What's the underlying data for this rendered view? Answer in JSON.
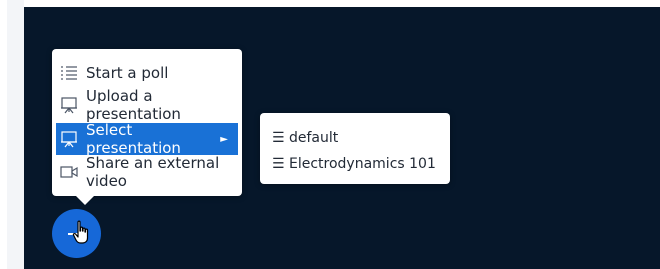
{
  "menu": {
    "items": [
      {
        "label": "Start a poll",
        "icon": "poll-list-icon",
        "selected": false
      },
      {
        "label": "Upload a presentation",
        "icon": "presentation-icon",
        "selected": false
      },
      {
        "label": "Select presentation",
        "icon": "presentation-icon",
        "selected": true
      },
      {
        "label": "Share an external video",
        "icon": "video-camera-icon",
        "selected": false
      }
    ],
    "submenu_arrow": "►"
  },
  "submenu": {
    "items": [
      {
        "label": "default",
        "icon": "☰"
      },
      {
        "label": "Electrodynamics 101",
        "icon": "☰"
      }
    ]
  },
  "fab": {
    "icon": "plus-icon"
  },
  "colors": {
    "stage": "#06172a",
    "accent": "#1971d6",
    "fab": "#1668d8"
  }
}
